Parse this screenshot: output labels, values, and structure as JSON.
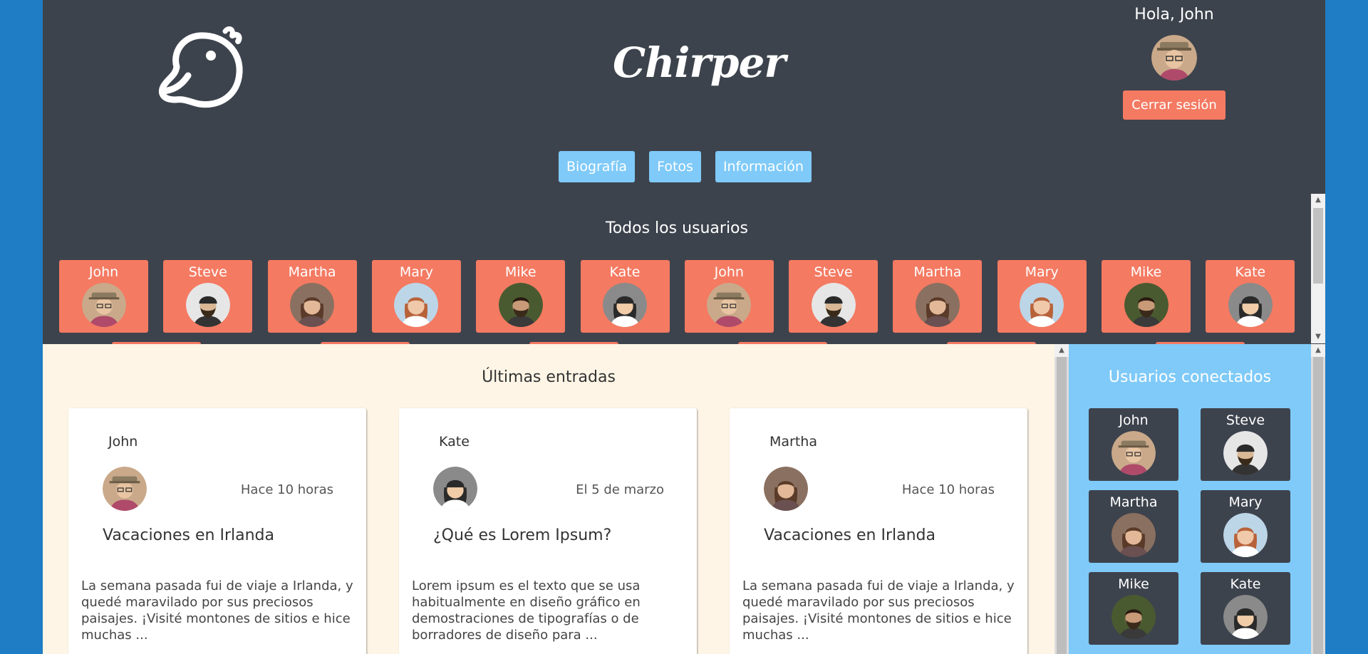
{
  "header": {
    "brand": "Chirper",
    "greeting": "Hola, John",
    "logout_label": "Cerrar sesión",
    "logo_icon": "bird-logo-icon"
  },
  "nav": {
    "items": [
      {
        "label": "Biografía"
      },
      {
        "label": "Fotos"
      },
      {
        "label": "Información"
      }
    ]
  },
  "all_users": {
    "title": "Todos los usuarios",
    "users": [
      {
        "name": "John"
      },
      {
        "name": "Steve"
      },
      {
        "name": "Martha"
      },
      {
        "name": "Mary"
      },
      {
        "name": "Mike"
      },
      {
        "name": "Kate"
      },
      {
        "name": "John"
      },
      {
        "name": "Steve"
      },
      {
        "name": "Martha"
      },
      {
        "name": "Mary"
      },
      {
        "name": "Mike"
      },
      {
        "name": "Kate"
      }
    ]
  },
  "posts": {
    "title": "Últimas entradas",
    "items": [
      {
        "author": "John",
        "date": "Hace 10 horas",
        "title": "Vacaciones en Irlanda",
        "body": "La semana pasada fui de viaje a Irlanda, y quedé maravilado por sus preciosos paisajes. ¡Visité montones de sitios e hice muchas ..."
      },
      {
        "author": "Kate",
        "date": "El 5 de marzo",
        "title": "¿Qué es Lorem Ipsum?",
        "body": "Lorem ipsum es el texto que se usa habitualmente en diseño gráfico en demostraciones de tipografías o de borradores de diseño para ..."
      },
      {
        "author": "Martha",
        "date": "Hace 10 horas",
        "title": "Vacaciones en Irlanda",
        "body": "La semana pasada fui de viaje a Irlanda, y quedé maravilado por sus preciosos paisajes. ¡Visité montones de sitios e hice muchas ..."
      }
    ]
  },
  "connected": {
    "title": "Usuarios conectados",
    "users": [
      {
        "name": "John"
      },
      {
        "name": "Steve"
      },
      {
        "name": "Martha"
      },
      {
        "name": "Mary"
      },
      {
        "name": "Mike"
      },
      {
        "name": "Kate"
      }
    ]
  },
  "colors": {
    "page_background": "#1e7dc5",
    "header_background": "#3d434d",
    "accent_coral": "#f47a62",
    "accent_light_blue": "#7fcaf8",
    "posts_background": "#fef5e6"
  }
}
